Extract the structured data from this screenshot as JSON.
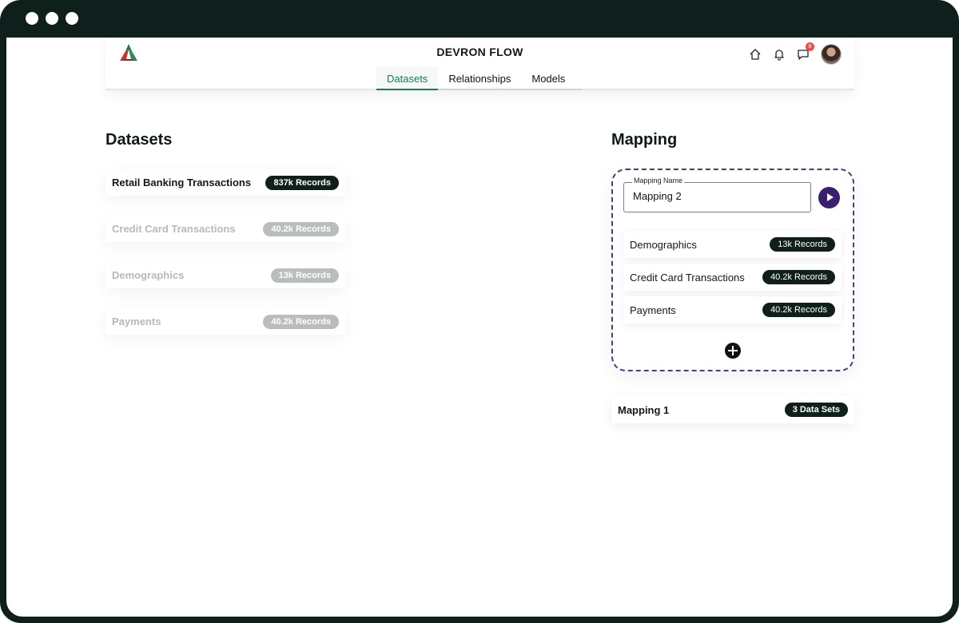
{
  "window": {
    "controls": [
      "window-dot-1",
      "window-dot-2",
      "window-dot-3"
    ]
  },
  "header": {
    "title": "DEVRON FLOW",
    "tabs": [
      {
        "label": "Datasets",
        "active": true
      },
      {
        "label": "Relationships",
        "active": false
      },
      {
        "label": "Models",
        "active": false
      }
    ],
    "icons": {
      "home": "home-icon",
      "bell": "bell-icon",
      "chat": "chat-icon",
      "chat_badge": "8"
    },
    "accent": "#1e7a56"
  },
  "datasets": {
    "heading": "Datasets",
    "items": [
      {
        "name": "Retail Banking Transactions",
        "records": "837k Records",
        "active": true
      },
      {
        "name": "Credit Card Transactions",
        "records": "40.2k Records",
        "active": false
      },
      {
        "name": "Demographics",
        "records": "13k Records",
        "active": false
      },
      {
        "name": "Payments",
        "records": "40.2k Records",
        "active": false
      }
    ]
  },
  "mapping": {
    "heading": "Mapping",
    "name_label": "Mapping Name",
    "name_value": "Mapping 2",
    "items": [
      {
        "name": "Demographics",
        "records": "13k Records"
      },
      {
        "name": "Credit Card Transactions",
        "records": "40.2k Records"
      },
      {
        "name": "Payments",
        "records": "40.2k Records"
      }
    ],
    "border_color": "#4b3a86",
    "saved": [
      {
        "name": "Mapping 1",
        "count": "3 Data Sets"
      }
    ]
  }
}
